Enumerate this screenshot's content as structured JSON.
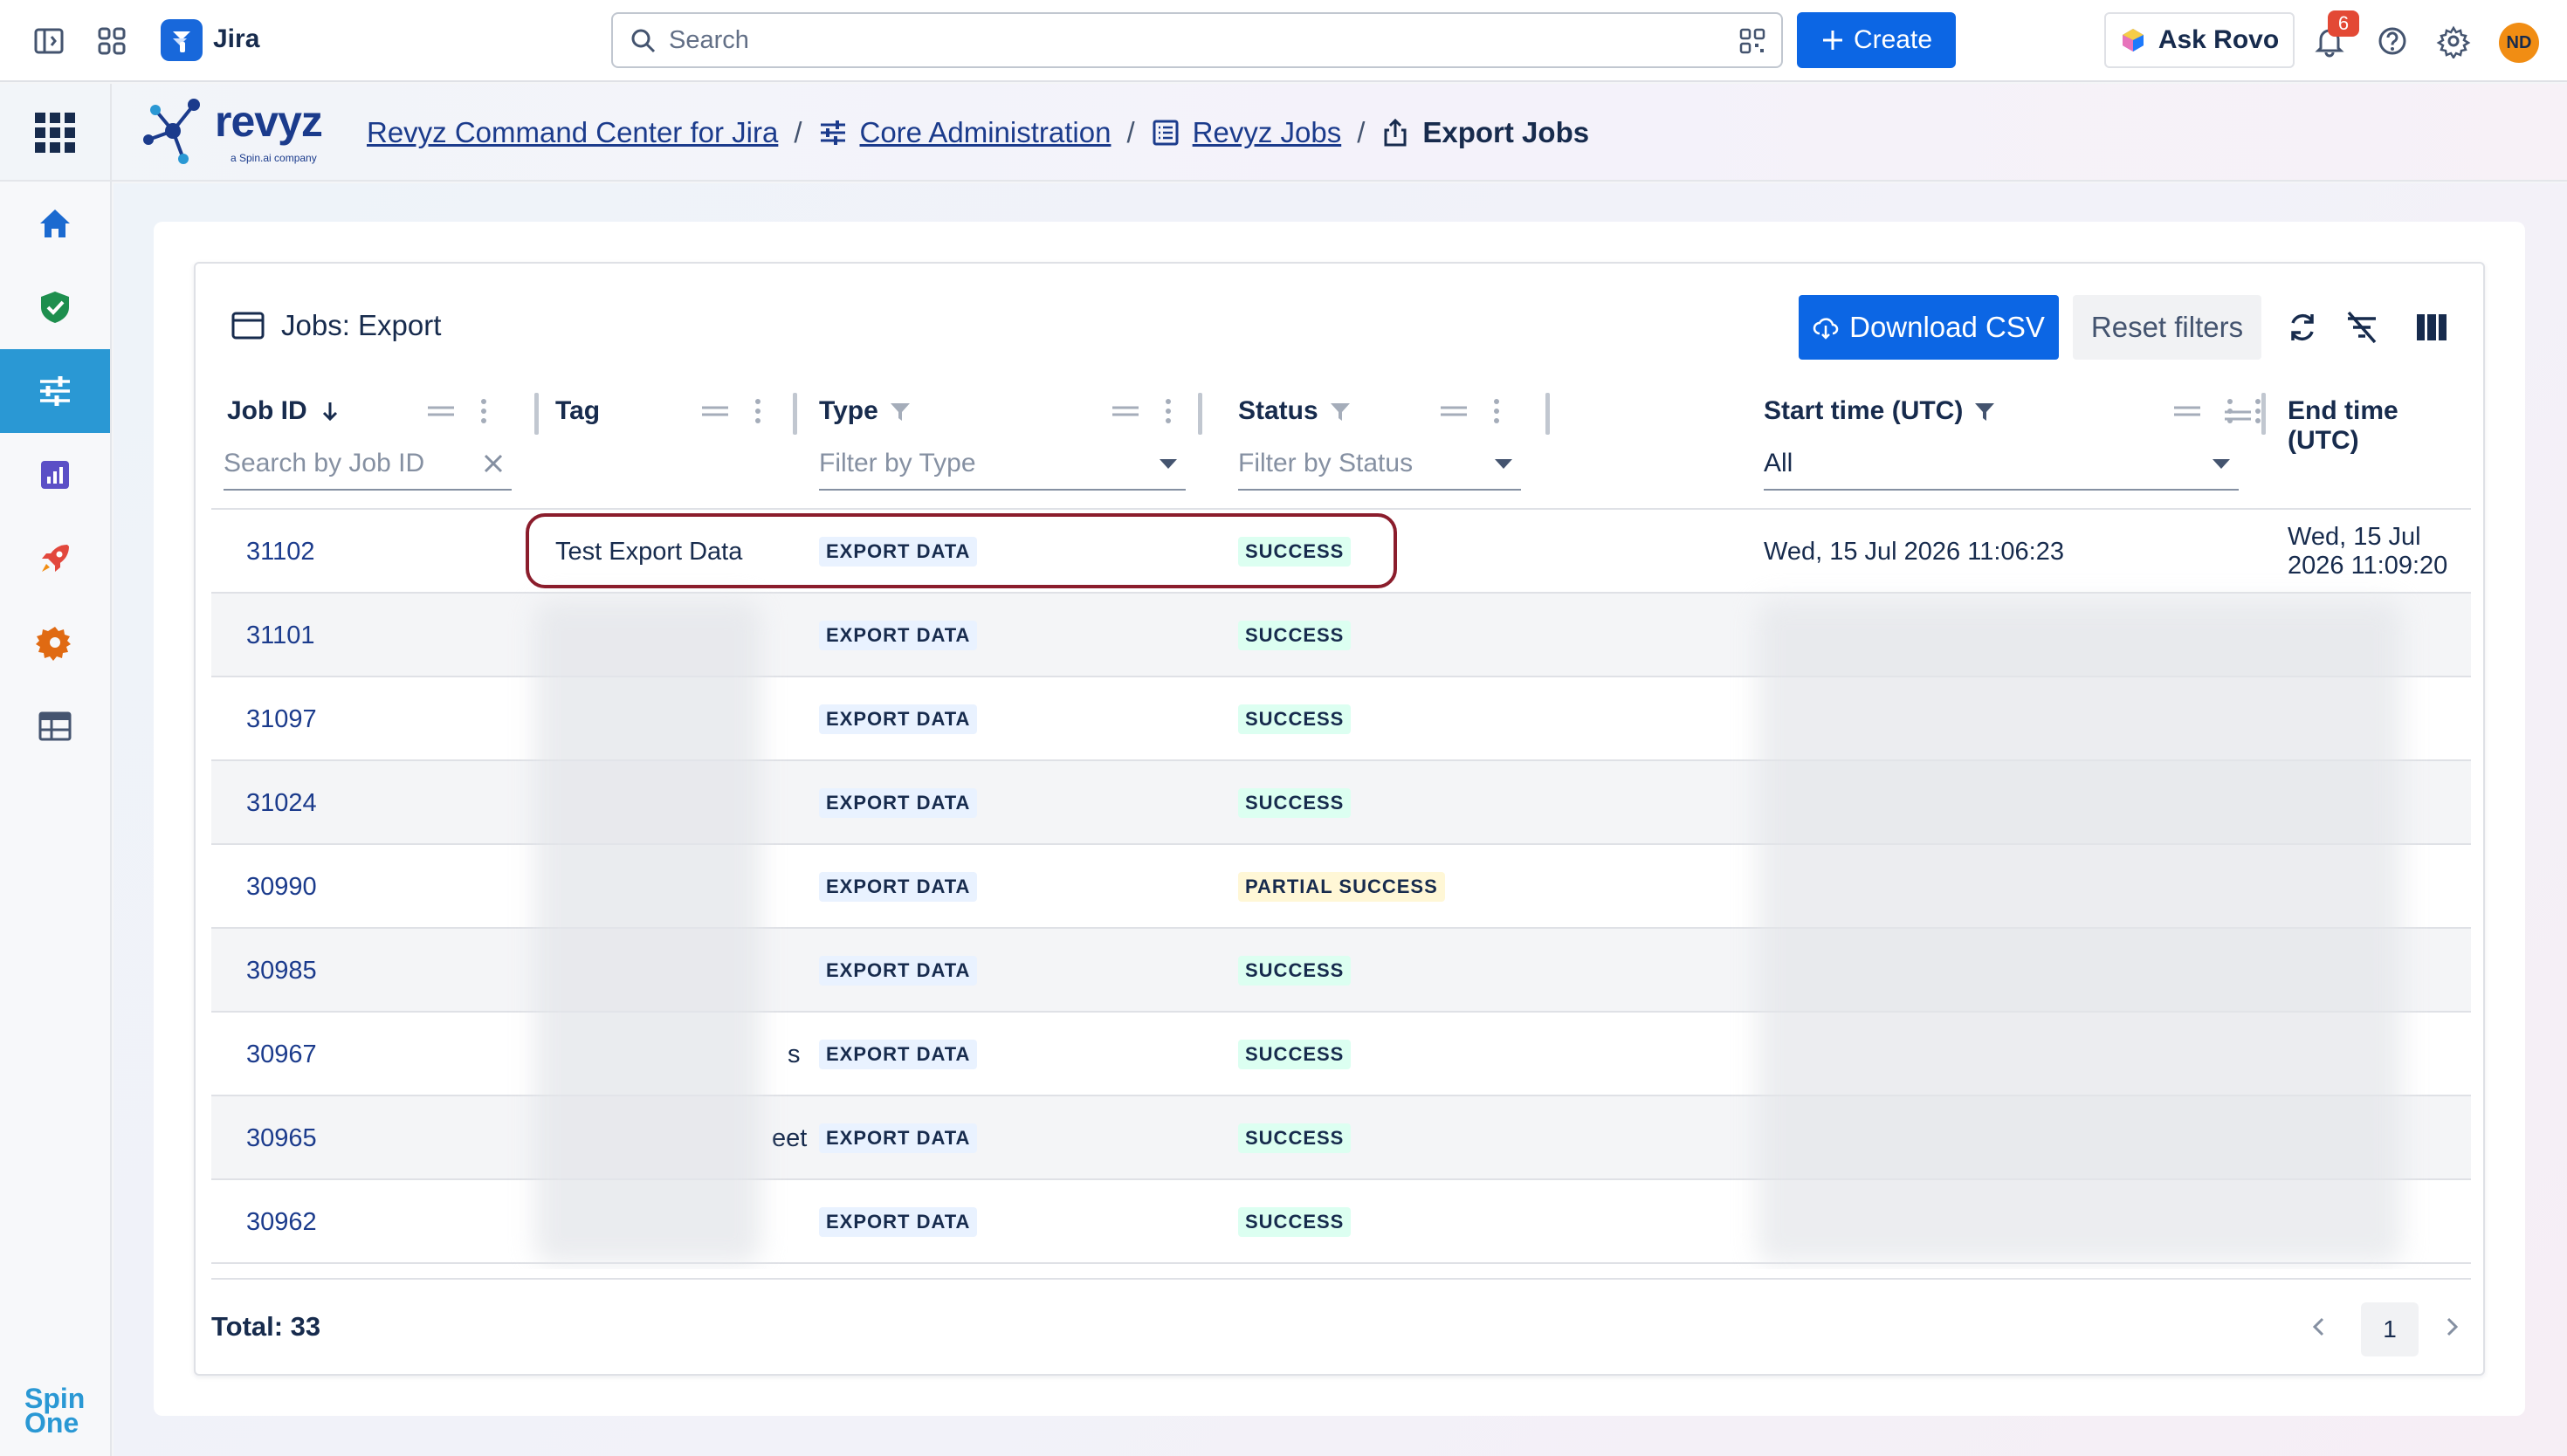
{
  "topbar": {
    "app_name": "Jira",
    "search_placeholder": "Search",
    "create_label": "Create",
    "rovo_label": "Ask Rovo",
    "notification_count": "6",
    "avatar_initials": "ND"
  },
  "app": {
    "brand": "revyz",
    "brand_tagline": "a Spin.ai company",
    "breadcrumbs": [
      "Revyz Command Center for Jira",
      "Core Administration",
      "Revyz Jobs"
    ],
    "current_page": "Export Jobs",
    "sidebar_footer": "Spin One"
  },
  "panel": {
    "title": "Jobs: Export",
    "download_label": "Download CSV",
    "reset_label": "Reset filters"
  },
  "table": {
    "columns": {
      "job_id": "Job ID",
      "tag": "Tag",
      "type": "Type",
      "status": "Status",
      "start": "Start time (UTC)",
      "end": "End time (UTC)"
    },
    "filters": {
      "job_id_placeholder": "Search by Job ID",
      "type_placeholder": "Filter by Type",
      "status_placeholder": "Filter by Status",
      "start_value": "All"
    },
    "rows": [
      {
        "job_id": "31102",
        "tag": "Test Export Data",
        "type": "EXPORT DATA",
        "status": "SUCCESS",
        "start": "Wed, 15 Jul 2026 11:06:23",
        "end": "Wed, 15 Jul 2026 11:09:20"
      },
      {
        "job_id": "31101",
        "tag": "",
        "type": "EXPORT DATA",
        "status": "SUCCESS",
        "start": "",
        "end": ""
      },
      {
        "job_id": "31097",
        "tag": "",
        "type": "EXPORT DATA",
        "status": "SUCCESS",
        "start": "",
        "end": ""
      },
      {
        "job_id": "31024",
        "tag": "",
        "type": "EXPORT DATA",
        "status": "SUCCESS",
        "start": "",
        "end": ""
      },
      {
        "job_id": "30990",
        "tag": "",
        "type": "EXPORT DATA",
        "status": "PARTIAL SUCCESS",
        "start": "",
        "end": ""
      },
      {
        "job_id": "30985",
        "tag": "",
        "type": "EXPORT DATA",
        "status": "SUCCESS",
        "start": "",
        "end": ""
      },
      {
        "job_id": "30967",
        "tag": "s",
        "type": "EXPORT DATA",
        "status": "SUCCESS",
        "start": "",
        "end": ""
      },
      {
        "job_id": "30965",
        "tag": "eet",
        "type": "EXPORT DATA",
        "status": "SUCCESS",
        "start": "",
        "end": ""
      },
      {
        "job_id": "30962",
        "tag": "",
        "type": "EXPORT DATA",
        "status": "SUCCESS",
        "start": "",
        "end": ""
      }
    ],
    "total_label": "Total: 33",
    "current_page": "1"
  },
  "colors": {
    "primary": "#0c66e4",
    "link": "#1b3b8c",
    "nav_active": "#2a98d4",
    "highlight": "#8b1d2c",
    "success_bg": "#dcfff1",
    "partial_bg": "#fff7d6",
    "type_bg": "#e9f2ff"
  }
}
